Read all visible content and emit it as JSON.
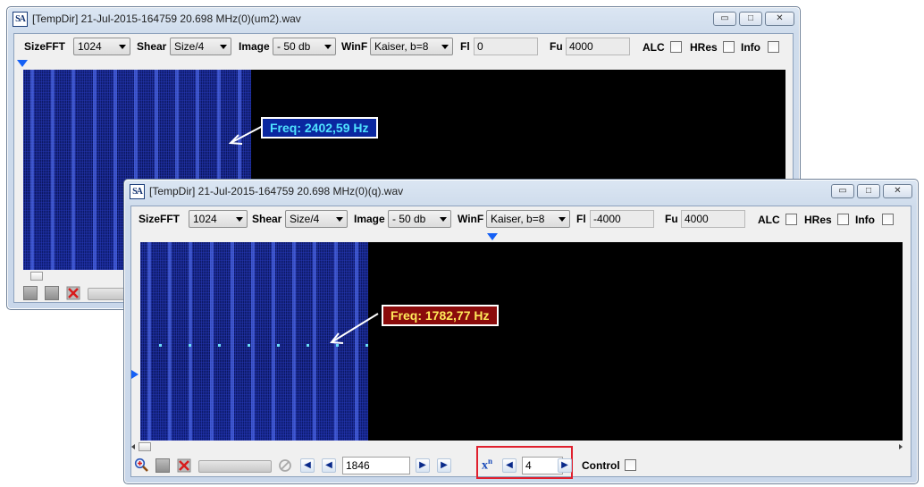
{
  "windows": [
    {
      "title": "[TempDir] 21-Jul-2015-164759 20.698 MHz(0)(um2).wav",
      "icon": "SA",
      "toolbar": {
        "sizefft_label": "SizeFFT",
        "sizefft_value": "1024",
        "shear_label": "Shear",
        "shear_value": "Size/4",
        "image_label": "Image",
        "image_value": "- 50 db",
        "winf_label": "WinF",
        "winf_value": "Kaiser, b=8",
        "fl_label": "Fl",
        "fl_value": "0",
        "fu_label": "Fu",
        "fu_value": "4000",
        "alc_label": "ALC",
        "hres_label": "HRes",
        "info_label": "Info"
      },
      "freq_label": "Freq: 2402,59 Hz",
      "freq_label_colors": {
        "text": "#4fe2ff",
        "background": "#0a27a0"
      }
    },
    {
      "title": "[TempDir] 21-Jul-2015-164759 20.698 MHz(0)(q).wav",
      "icon": "SA",
      "toolbar": {
        "sizefft_label": "SizeFFT",
        "sizefft_value": "1024",
        "shear_label": "Shear",
        "shear_value": "Size/4",
        "image_label": "Image",
        "image_value": "- 50 db",
        "winf_label": "WinF",
        "winf_value": "Kaiser, b=8",
        "fl_label": "Fl",
        "fl_value": "-4000",
        "fu_label": "Fu",
        "fu_value": "4000",
        "alc_label": "ALC",
        "hres_label": "HRes",
        "info_label": "Info"
      },
      "freq_label": "Freq: 1782,77 Hz",
      "freq_label_colors": {
        "text": "#ffe95a",
        "background": "#8a0b0b"
      },
      "bottom": {
        "position_value": "1846",
        "xn_label": "x",
        "xn_superscript": "n",
        "xn_value": "4",
        "control_label": "Control"
      }
    }
  ],
  "window_buttons": {
    "minimize": "▭",
    "maximize": "□",
    "close": "✕"
  },
  "colors": {
    "spectrogram_background": "#000000",
    "marker": "#1560f5",
    "highlight": "#e0202e"
  }
}
